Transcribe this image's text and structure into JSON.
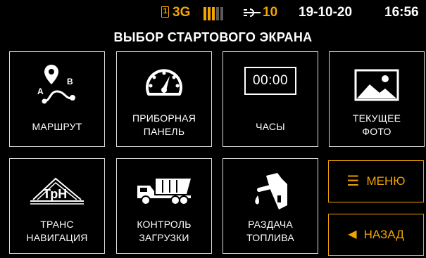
{
  "status": {
    "sim_number": "1",
    "network": "3G",
    "signal_level": 3,
    "signal_max": 5,
    "satellites": "10",
    "date": "19-10-20",
    "time": "16:56"
  },
  "title": "ВЫБОР СТАРТОВОГО ЭКРАНА",
  "tiles": {
    "route": {
      "line1": "МАРШРУТ",
      "line2": "",
      "icon": "route-icon",
      "marker_a": "A",
      "marker_b": "B"
    },
    "dashboard": {
      "line1": "ПРИБОРНАЯ",
      "line2": "ПАНЕЛЬ",
      "icon": "speedometer-icon"
    },
    "clock": {
      "line1": "ЧАСЫ",
      "line2": "",
      "icon": "digital-clock-icon",
      "clock_value": "00:00"
    },
    "photo": {
      "line1": "ТЕКУЩЕЕ",
      "line2": "ФОТО",
      "icon": "photo-icon"
    },
    "transnav": {
      "line1": "ТРАНС",
      "line2": "НАВИГАЦИЯ",
      "icon": "transnavigation-logo",
      "logo_text": "ТрН"
    },
    "loading": {
      "line1": "КОНТРОЛЬ",
      "line2": "ЗАГРУЗКИ",
      "icon": "dump-truck-icon"
    },
    "fuel": {
      "line1": "РАЗДАЧА",
      "line2": "ТОПЛИВА",
      "icon": "fuel-nozzle-icon"
    }
  },
  "buttons": {
    "menu": {
      "label": "МЕНЮ",
      "icon": "hamburger-icon"
    },
    "back": {
      "label": "НАЗАД",
      "icon": "arrow-left-icon"
    }
  },
  "colors": {
    "accent": "#f2a400",
    "background": "#000000",
    "border": "#d9d9d9",
    "text": "#ffffff"
  }
}
